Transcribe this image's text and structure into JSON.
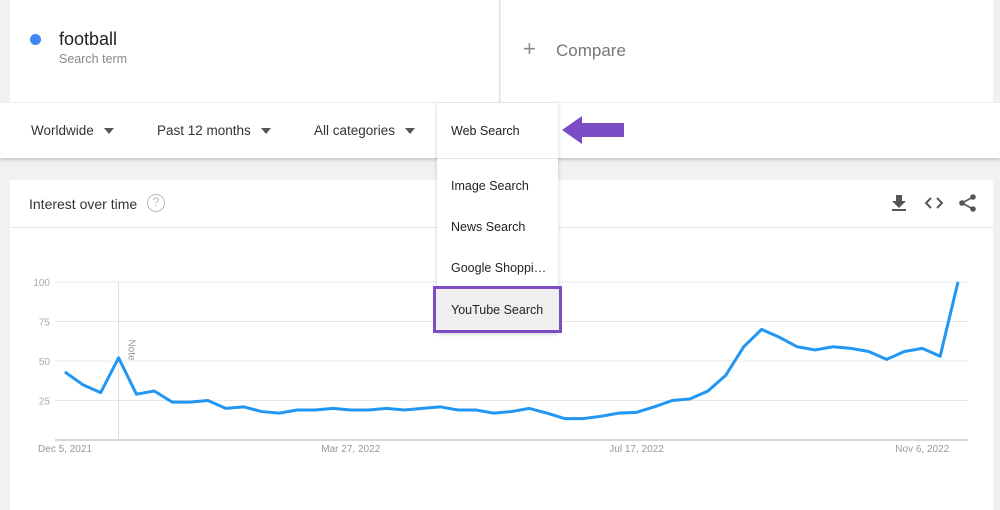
{
  "search": {
    "term": "football",
    "term_sub": "Search term",
    "term_color": "#4285f4",
    "compare_label": "Compare",
    "plus_icon": "plus-icon"
  },
  "filters": {
    "region": "Worldwide",
    "time": "Past 12 months",
    "category": "All categories",
    "search_type": "Web Search"
  },
  "dropdown": {
    "items": [
      "Web Search",
      "Image Search",
      "News Search",
      "Google Shoppi…",
      "YouTube Search"
    ],
    "highlighted": "YouTube Search",
    "highlight_color": "#7b4cc4"
  },
  "annotation": {
    "arrow_color": "#7b4cc4",
    "arrow_icon": "arrow-left-icon"
  },
  "card": {
    "title": "Interest over time",
    "help_icon": "?",
    "actions": [
      "download-icon",
      "embed-icon",
      "share-icon"
    ]
  },
  "chart_data": {
    "type": "line",
    "series_color": "#2196f3",
    "ylim": [
      0,
      100
    ],
    "yticks": [
      "25",
      "50",
      "75",
      "100"
    ],
    "xtick_labels": [
      "Dec 5, 2021",
      "Mar 27, 2022",
      "Jul 17, 2022",
      "Nov 6, 2022"
    ],
    "note_label": "Note",
    "grid": true,
    "x_start": "Dec 5, 2021",
    "x_interval": "weekly",
    "values": [
      43,
      35,
      30,
      52,
      29,
      31,
      24,
      24,
      25,
      20,
      21,
      18,
      17,
      19,
      19,
      20,
      19,
      19,
      20,
      19,
      20,
      21,
      19,
      19,
      17,
      18,
      20,
      17,
      13.5,
      13.5,
      15,
      17,
      17.5,
      21,
      25,
      26,
      31,
      41,
      59,
      70,
      65,
      59,
      57,
      59,
      58,
      56,
      51,
      56,
      58,
      53,
      100
    ]
  }
}
